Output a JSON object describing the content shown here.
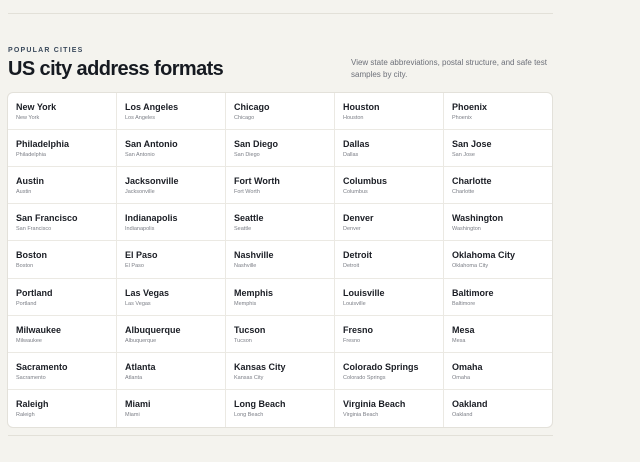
{
  "header": {
    "eyebrow": "POPULAR CITIES",
    "title": "US city address formats",
    "description": "View state abbreviations, postal structure, and safe test samples by city."
  },
  "cities": [
    {
      "name": "New York",
      "sub": "New York"
    },
    {
      "name": "Los Angeles",
      "sub": "Los Angeles"
    },
    {
      "name": "Chicago",
      "sub": "Chicago"
    },
    {
      "name": "Houston",
      "sub": "Houston"
    },
    {
      "name": "Phoenix",
      "sub": "Phoenix"
    },
    {
      "name": "Philadelphia",
      "sub": "Philadelphia"
    },
    {
      "name": "San Antonio",
      "sub": "San Antonio"
    },
    {
      "name": "San Diego",
      "sub": "San Diego"
    },
    {
      "name": "Dallas",
      "sub": "Dallas"
    },
    {
      "name": "San Jose",
      "sub": "San Jose"
    },
    {
      "name": "Austin",
      "sub": "Austin"
    },
    {
      "name": "Jacksonville",
      "sub": "Jacksonville"
    },
    {
      "name": "Fort Worth",
      "sub": "Fort Worth"
    },
    {
      "name": "Columbus",
      "sub": "Columbus"
    },
    {
      "name": "Charlotte",
      "sub": "Charlotte"
    },
    {
      "name": "San Francisco",
      "sub": "San Francisco"
    },
    {
      "name": "Indianapolis",
      "sub": "Indianapolis"
    },
    {
      "name": "Seattle",
      "sub": "Seattle"
    },
    {
      "name": "Denver",
      "sub": "Denver"
    },
    {
      "name": "Washington",
      "sub": "Washington"
    },
    {
      "name": "Boston",
      "sub": "Boston"
    },
    {
      "name": "El Paso",
      "sub": "El Paso"
    },
    {
      "name": "Nashville",
      "sub": "Nashville"
    },
    {
      "name": "Detroit",
      "sub": "Detroit"
    },
    {
      "name": "Oklahoma City",
      "sub": "Oklahoma City"
    },
    {
      "name": "Portland",
      "sub": "Portland"
    },
    {
      "name": "Las Vegas",
      "sub": "Las Vegas"
    },
    {
      "name": "Memphis",
      "sub": "Memphis"
    },
    {
      "name": "Louisville",
      "sub": "Louisville"
    },
    {
      "name": "Baltimore",
      "sub": "Baltimore"
    },
    {
      "name": "Milwaukee",
      "sub": "Milwaukee"
    },
    {
      "name": "Albuquerque",
      "sub": "Albuquerque"
    },
    {
      "name": "Tucson",
      "sub": "Tucson"
    },
    {
      "name": "Fresno",
      "sub": "Fresno"
    },
    {
      "name": "Mesa",
      "sub": "Mesa"
    },
    {
      "name": "Sacramento",
      "sub": "Sacramento"
    },
    {
      "name": "Atlanta",
      "sub": "Atlanta"
    },
    {
      "name": "Kansas City",
      "sub": "Kansas City"
    },
    {
      "name": "Colorado Springs",
      "sub": "Colorado Springs"
    },
    {
      "name": "Omaha",
      "sub": "Omaha"
    },
    {
      "name": "Raleigh",
      "sub": "Raleigh"
    },
    {
      "name": "Miami",
      "sub": "Miami"
    },
    {
      "name": "Long Beach",
      "sub": "Long Beach"
    },
    {
      "name": "Virginia Beach",
      "sub": "Virginia Beach"
    },
    {
      "name": "Oakland",
      "sub": "Oakland"
    }
  ]
}
